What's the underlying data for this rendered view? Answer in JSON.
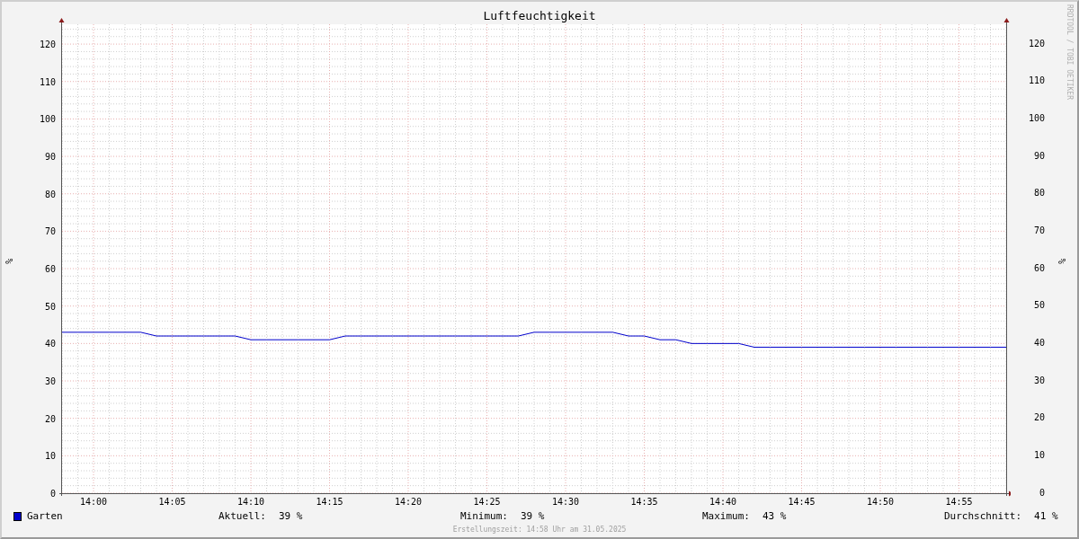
{
  "title": "Luftfeuchtigkeit",
  "credit": "RRDTOOL / TOBI OETIKER",
  "chart_data": {
    "type": "line",
    "grid": true,
    "ylabel": "%",
    "ylim": [
      0,
      125.3
    ],
    "categories": [
      null,
      null,
      "14:00",
      null,
      null,
      null,
      null,
      "14:05",
      null,
      null,
      null,
      null,
      "14:10",
      null,
      null,
      null,
      null,
      "14:15",
      null,
      null,
      null,
      null,
      "14:20",
      null,
      null,
      null,
      null,
      "14:25",
      null,
      null,
      null,
      null,
      "14:30",
      null,
      null,
      null,
      null,
      "14:35",
      null,
      null,
      null,
      null,
      "14:40",
      null,
      null,
      null,
      null,
      "14:45",
      null,
      null,
      null,
      null,
      "14:50",
      null,
      null,
      null,
      null,
      "14:55",
      null,
      null,
      null
    ],
    "series": [
      {
        "name": "Garten",
        "color": "#0000cc",
        "values": [
          43,
          43,
          43,
          43,
          43,
          43,
          42,
          42,
          42,
          42,
          42,
          42,
          41,
          41,
          41,
          41,
          41,
          41,
          42,
          42,
          42,
          42,
          42,
          42,
          42,
          42,
          42,
          42,
          42,
          42,
          43,
          43,
          43,
          43,
          43,
          43,
          42,
          42,
          41,
          41,
          40,
          40,
          40,
          40,
          39,
          39,
          39,
          39,
          39,
          39,
          39,
          39,
          39,
          39,
          39,
          39,
          39,
          39,
          39,
          39,
          39
        ]
      }
    ],
    "yticks": [
      0,
      10,
      20,
      30,
      40,
      50,
      60,
      70,
      80,
      90,
      100,
      110,
      120
    ]
  },
  "right_scale": {
    "unit": "%",
    "numbers": [
      "120",
      "110",
      "100",
      "90",
      "80",
      "70",
      "60",
      "50",
      "40",
      "30",
      "20",
      "10",
      "0"
    ]
  },
  "stats": [
    {
      "label": "Aktuell:",
      "value": "39 %"
    },
    {
      "label": "Minimum:",
      "value": "39 %"
    },
    {
      "label": "Maximum:",
      "value": "43 %"
    },
    {
      "label": "Durchschnitt:",
      "value": "41 %"
    }
  ],
  "footer": "Erstellungszeit: 14:58 Uhr am 31.05.2025"
}
